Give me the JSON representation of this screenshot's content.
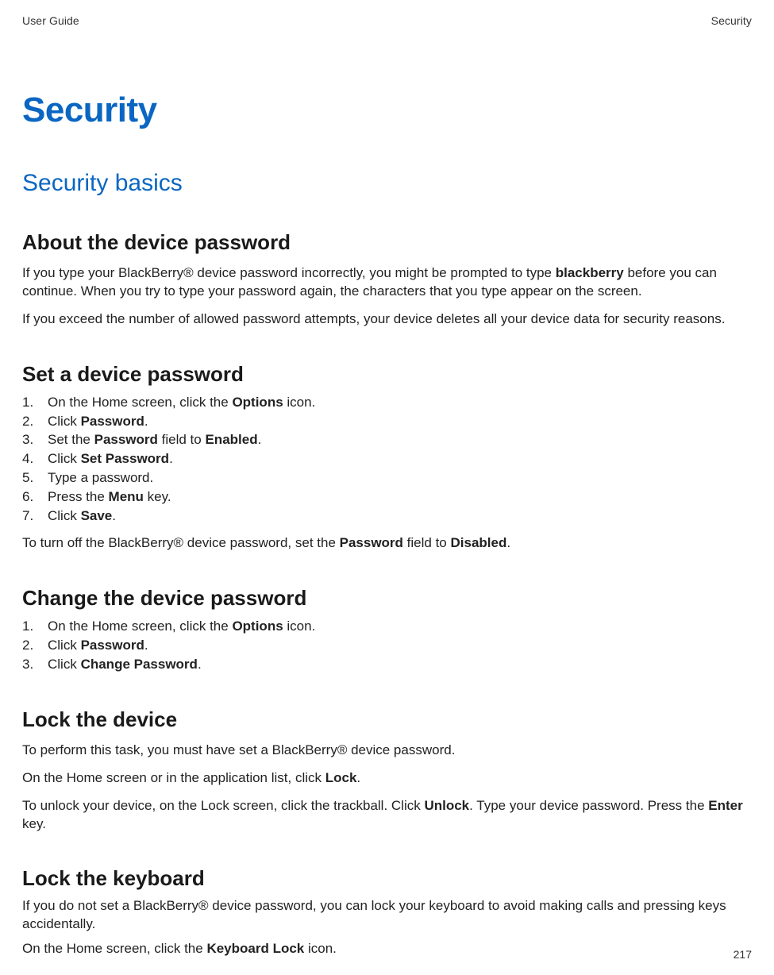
{
  "header": {
    "left": "User Guide",
    "right": "Security"
  },
  "page_title": "Security",
  "section_title": "Security basics",
  "about": {
    "heading": "About the device password",
    "p1_a": "If you type your BlackBerry® device password incorrectly, you might be prompted to type ",
    "p1_bold": "blackberry",
    "p1_b": " before you can continue. When you try to type your password again, the characters that you type appear on the screen.",
    "p2": "If you exceed the number of allowed password attempts, your device deletes all your device data for security reasons."
  },
  "set": {
    "heading": "Set a device password",
    "steps": {
      "s1a": "On the Home screen, click the ",
      "s1b": "Options",
      "s1c": " icon.",
      "s2a": "Click ",
      "s2b": "Password",
      "s2c": ".",
      "s3a": "Set the ",
      "s3b": "Password",
      "s3c": " field to ",
      "s3d": "Enabled",
      "s3e": ".",
      "s4a": "Click ",
      "s4b": "Set Password",
      "s4c": ".",
      "s5": "Type a password.",
      "s6a": "Press the ",
      "s6b": "Menu",
      "s6c": " key.",
      "s7a": "Click ",
      "s7b": "Save",
      "s7c": "."
    },
    "note_a": "To turn off the BlackBerry® device password, set the ",
    "note_b": "Password",
    "note_c": " field to ",
    "note_d": "Disabled",
    "note_e": "."
  },
  "change": {
    "heading": "Change the device password",
    "steps": {
      "s1a": "On the Home screen, click the ",
      "s1b": "Options",
      "s1c": " icon.",
      "s2a": "Click ",
      "s2b": "Password",
      "s2c": ".",
      "s3a": "Click ",
      "s3b": "Change Password",
      "s3c": "."
    }
  },
  "lockdev": {
    "heading": "Lock the device",
    "p1": "To perform this task, you must have set a BlackBerry® device password.",
    "p2a": "On the Home screen or in the application list, click ",
    "p2b": "Lock",
    "p2c": ".",
    "p3a": "To unlock your device, on the Lock screen, click the trackball. Click ",
    "p3b": "Unlock",
    "p3c": ". Type your device password. Press the ",
    "p3d": "Enter",
    "p3e": " key."
  },
  "lockkb": {
    "heading": "Lock the keyboard",
    "p1": "If you do not set a BlackBerry® device password, you can lock your keyboard to avoid making calls and pressing keys accidentally.",
    "p2a": "On the Home screen, click the ",
    "p2b": "Keyboard Lock",
    "p2c": " icon."
  },
  "page_number": "217"
}
